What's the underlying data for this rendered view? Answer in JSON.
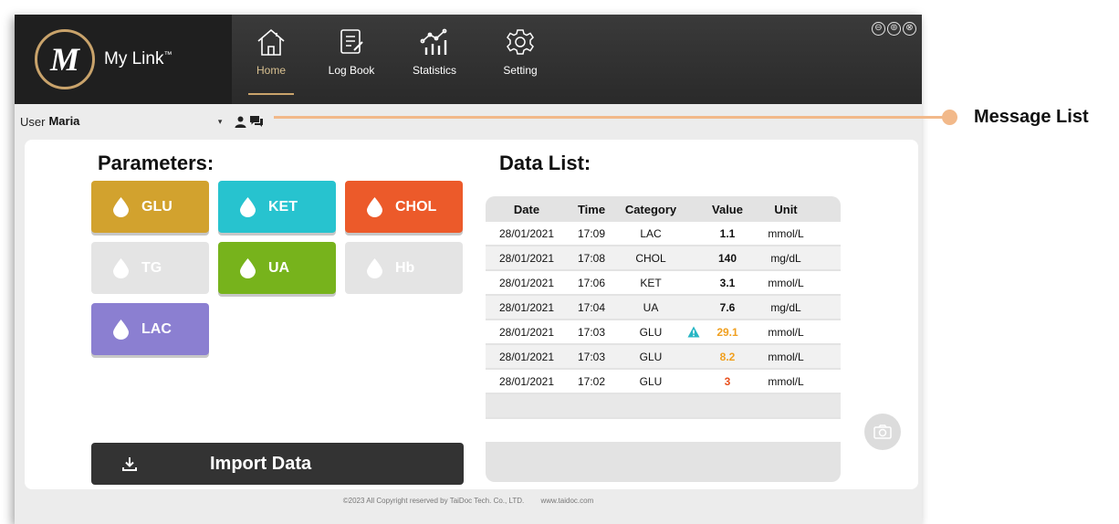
{
  "app": {
    "logo_initials": "M",
    "logo_text": "My Link",
    "logo_tm": "™",
    "window_controls": [
      "⊖",
      "⊚",
      "⊗"
    ]
  },
  "nav": {
    "home": "Home",
    "log_book": "Log Book",
    "statistics": "Statistics",
    "setting": "Setting"
  },
  "user": {
    "label": "User",
    "selected": "Maria",
    "caret": "▾"
  },
  "parameters": {
    "title": "Parameters:",
    "buttons": [
      {
        "label": "GLU",
        "color": "#d2a22e",
        "enabled": true
      },
      {
        "label": "KET",
        "color": "#27c3cf",
        "enabled": true
      },
      {
        "label": "CHOL",
        "color": "#ec5a2a",
        "enabled": true
      },
      {
        "label": "TG",
        "color": "#e4e4e4",
        "enabled": false
      },
      {
        "label": "UA",
        "color": "#77b31c",
        "enabled": true
      },
      {
        "label": "Hb",
        "color": "#e4e4e4",
        "enabled": false
      },
      {
        "label": "LAC",
        "color": "#8b7fd1",
        "enabled": true
      }
    ]
  },
  "import_button": {
    "label": "Import Data"
  },
  "data_list": {
    "title": "Data List:",
    "headers": {
      "date": "Date",
      "time": "Time",
      "category": "Category",
      "value": "Value",
      "unit": "Unit"
    },
    "rows": [
      {
        "date": "28/01/2021",
        "time": "17:09",
        "category": "LAC",
        "warn": false,
        "value": "1.1",
        "value_color": "#111111",
        "unit": "mmol/L"
      },
      {
        "date": "28/01/2021",
        "time": "17:08",
        "category": "CHOL",
        "warn": false,
        "value": "140",
        "value_color": "#111111",
        "unit": "mg/dL"
      },
      {
        "date": "28/01/2021",
        "time": "17:06",
        "category": "KET",
        "warn": false,
        "value": "3.1",
        "value_color": "#111111",
        "unit": "mmol/L"
      },
      {
        "date": "28/01/2021",
        "time": "17:04",
        "category": "UA",
        "warn": false,
        "value": "7.6",
        "value_color": "#111111",
        "unit": "mg/dL"
      },
      {
        "date": "28/01/2021",
        "time": "17:03",
        "category": "GLU",
        "warn": true,
        "value": "29.1",
        "value_color": "#f0a020",
        "unit": "mmol/L"
      },
      {
        "date": "28/01/2021",
        "time": "17:03",
        "category": "GLU",
        "warn": false,
        "value": "8.2",
        "value_color": "#f0a020",
        "unit": "mmol/L"
      },
      {
        "date": "28/01/2021",
        "time": "17:02",
        "category": "GLU",
        "warn": false,
        "value": "3",
        "value_color": "#e8501e",
        "unit": "mmol/L"
      }
    ]
  },
  "footer": {
    "copyright": "©2023 All Copyright reserved by TaiDoc Tech. Co., LTD.",
    "website": "www.taidoc.com"
  },
  "annotation": {
    "label": "Message List",
    "color": "#f2b98a"
  }
}
